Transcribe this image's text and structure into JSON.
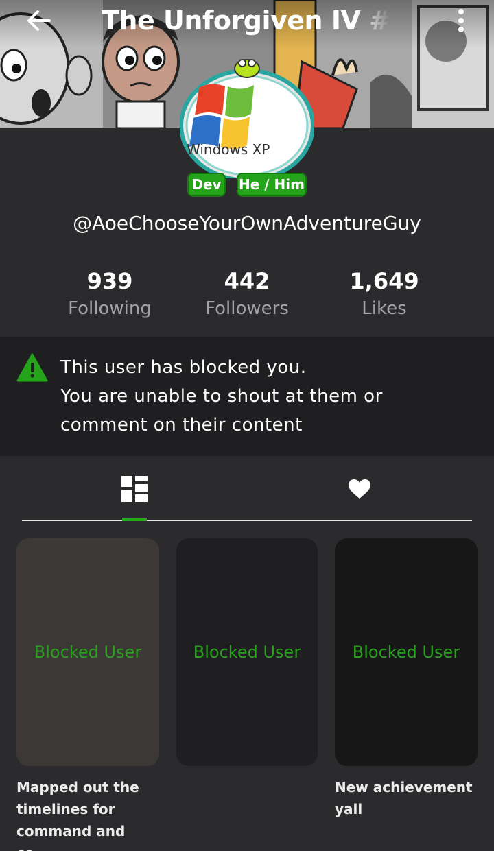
{
  "topbar": {
    "title": "The Unforgiven IV #acc",
    "back_icon": "arrow-left-icon",
    "more_icon": "more-vertical-icon"
  },
  "avatar": {
    "image_text": "Windows XP"
  },
  "badges": {
    "role": "Dev",
    "pronouns": "He / Him"
  },
  "profile": {
    "username": "@AoeChooseYourOwnAdventureGuy"
  },
  "stats": {
    "following": {
      "value": "939",
      "label": "Following"
    },
    "followers": {
      "value": "442",
      "label": "Followers"
    },
    "likes": {
      "value": "1,649",
      "label": "Likes"
    }
  },
  "notice": {
    "icon": "warning-icon",
    "line1": "This user has blocked you.",
    "line2": "You are unable to shout at them or",
    "line3": "comment on their content"
  },
  "tabs": {
    "posts_icon": "grid-layout-icon",
    "likes_icon": "heart-icon"
  },
  "posts": [
    {
      "label": "Blocked User",
      "caption_lines": [
        "Mapped out the",
        "timelines for",
        "command and co..."
      ]
    },
    {
      "label": "Blocked User",
      "caption_lines": []
    },
    {
      "label": "Blocked User",
      "caption_lines": [
        "New achievement",
        "yall"
      ]
    }
  ],
  "colors": {
    "accent_green": "#25a31a",
    "background": "#2b2a2c",
    "notice_bg": "#1f1e20",
    "muted_text": "#a3a3a5"
  }
}
